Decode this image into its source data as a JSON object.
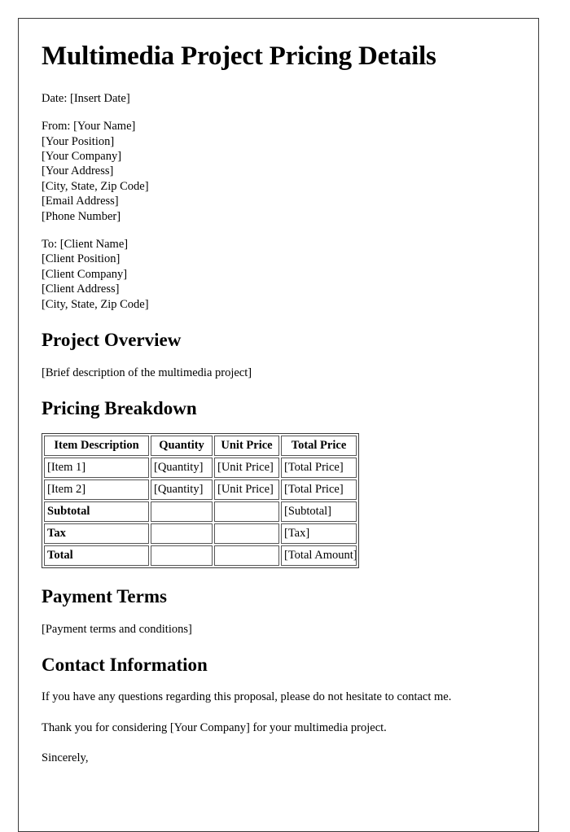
{
  "document": {
    "title": "Multimedia Project Pricing Details",
    "date_line": "Date: [Insert Date]",
    "from_block": [
      "From: [Your Name]",
      "[Your Position]",
      "[Your Company]",
      "[Your Address]",
      "[City, State, Zip Code]",
      "[Email Address]",
      "[Phone Number]"
    ],
    "to_block": [
      "To: [Client Name]",
      "[Client Position]",
      "[Client Company]",
      "[Client Address]",
      "[City, State, Zip Code]"
    ],
    "sections": {
      "project_overview": {
        "heading": "Project Overview",
        "body": "[Brief description of the multimedia project]"
      },
      "pricing_breakdown": {
        "heading": "Pricing Breakdown"
      },
      "payment_terms": {
        "heading": "Payment Terms",
        "body": "[Payment terms and conditions]"
      },
      "contact_information": {
        "heading": "Contact Information",
        "paragraph_1": "If you have any questions regarding this proposal, please do not hesitate to contact me.",
        "paragraph_2": "Thank you for considering [Your Company] for your multimedia project.",
        "closing": "Sincerely,"
      }
    },
    "pricing_table": {
      "headers": [
        "Item Description",
        "Quantity",
        "Unit Price",
        "Total Price"
      ],
      "rows": [
        {
          "cells": [
            "[Item 1]",
            "[Quantity]",
            "[Unit Price]",
            "[Total Price]"
          ],
          "bold_first": false
        },
        {
          "cells": [
            "[Item 2]",
            "[Quantity]",
            "[Unit Price]",
            "[Total Price]"
          ],
          "bold_first": false
        },
        {
          "cells": [
            "Subtotal",
            "",
            "",
            "[Subtotal]"
          ],
          "bold_first": true
        },
        {
          "cells": [
            "Tax",
            "",
            "",
            "[Tax]"
          ],
          "bold_first": true
        },
        {
          "cells": [
            "Total",
            "",
            "",
            "[Total Amount]"
          ],
          "bold_first": true
        }
      ]
    }
  }
}
